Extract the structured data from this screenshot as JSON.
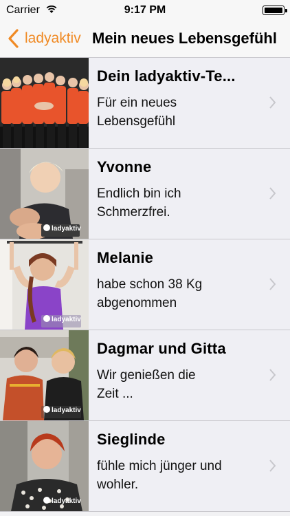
{
  "status": {
    "carrier": "Carrier",
    "time": "9:17 PM"
  },
  "nav": {
    "back_label": "ladyaktiv",
    "title": "Mein neues Lebensgefühl"
  },
  "brand": {
    "accent": "#f08a24",
    "watermark": "ladyaktiv"
  },
  "rows": [
    {
      "title": "Dein ladyaktiv-Te...",
      "subtitle_line1": "Für ein neues",
      "subtitle_line2": "Lebensgefühl"
    },
    {
      "title": "Yvonne",
      "subtitle_line1": "Endlich bin ich",
      "subtitle_line2": "Schmerzfrei."
    },
    {
      "title": "Melanie",
      "subtitle_line1": "habe schon 38 Kg",
      "subtitle_line2": "abgenommen"
    },
    {
      "title": "Dagmar und Gitta",
      "subtitle_line1": "Wir genießen die",
      "subtitle_line2": "Zeit ..."
    },
    {
      "title": "Sieglinde",
      "subtitle_line1": "fühle mich jünger und",
      "subtitle_line2": "wohler."
    }
  ]
}
